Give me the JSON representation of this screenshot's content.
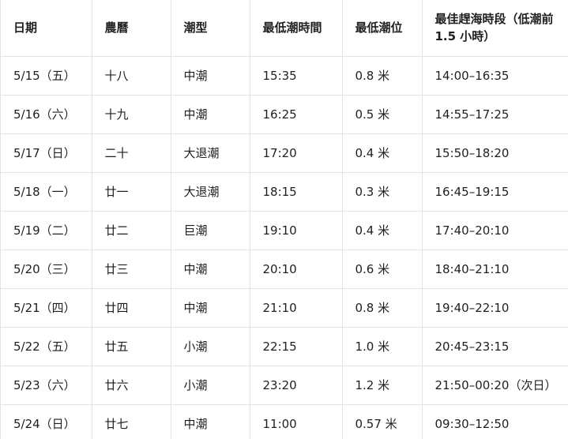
{
  "headers": [
    "日期",
    "農曆",
    "潮型",
    "最低潮時間",
    "最低潮位",
    "最佳趕海時段（低潮前 1.5 小時）"
  ],
  "rows": [
    [
      "5/15（五）",
      "十八",
      "中潮",
      "15:35",
      "0.8 米",
      "14:00–16:35"
    ],
    [
      "5/16（六）",
      "十九",
      "中潮",
      "16:25",
      "0.5 米",
      "14:55–17:25"
    ],
    [
      "5/17（日）",
      "二十",
      "大退潮",
      "17:20",
      "0.4 米",
      "15:50–18:20"
    ],
    [
      "5/18（一）",
      "廿一",
      "大退潮",
      "18:15",
      "0.3 米",
      "16:45–19:15"
    ],
    [
      "5/19（二）",
      "廿二",
      "巨潮",
      "19:10",
      "0.4 米",
      "17:40–20:10"
    ],
    [
      "5/20（三）",
      "廿三",
      "中潮",
      "20:10",
      "0.6 米",
      "18:40–21:10"
    ],
    [
      "5/21（四）",
      "廿四",
      "中潮",
      "21:10",
      "0.8 米",
      "19:40–22:10"
    ],
    [
      "5/22（五）",
      "廿五",
      "小潮",
      "22:15",
      "1.0 米",
      "20:45–23:15"
    ],
    [
      "5/23（六）",
      "廿六",
      "小潮",
      "23:20",
      "1.2 米",
      "21:50–00:20（次日）"
    ],
    [
      "5/24（日）",
      "廿七",
      "中潮",
      "11:00",
      "0.57 米",
      "09:30–12:50"
    ]
  ]
}
